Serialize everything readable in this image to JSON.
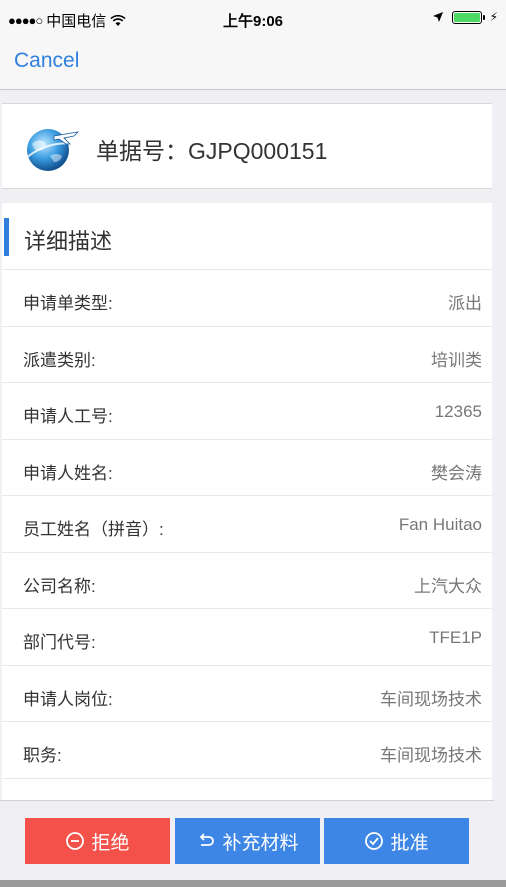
{
  "status_bar": {
    "signal": "●●●●○",
    "carrier": "中国电信",
    "time": "上午9:06",
    "battery_level": 1.0
  },
  "nav": {
    "cancel_label": "Cancel"
  },
  "document": {
    "number_label": "单据号：",
    "number_value": "GJPQ000151"
  },
  "section": {
    "title": "详细描述",
    "rows": [
      {
        "label": "申请单类型:",
        "value": "派出"
      },
      {
        "label": "派遣类别:",
        "value": "培训类"
      },
      {
        "label": "申请人工号:",
        "value": "12365"
      },
      {
        "label": "申请人姓名:",
        "value": "樊会涛"
      },
      {
        "label": "员工姓名（拼音）:",
        "value": "Fan Huitao"
      },
      {
        "label": "公司名称:",
        "value": "上汽大众"
      },
      {
        "label": "部门代号:",
        "value": "TFE1P"
      },
      {
        "label": "申请人岗位:",
        "value": "车间现场技术"
      },
      {
        "label": "职务:",
        "value": "车间现场技术"
      }
    ]
  },
  "actions": {
    "reject_label": "拒绝",
    "supplement_label": "补充材料",
    "approve_label": "批准"
  },
  "colors": {
    "accent": "#2f7fdf",
    "reject": "#f4514a",
    "primary_button": "#3d86e6"
  }
}
